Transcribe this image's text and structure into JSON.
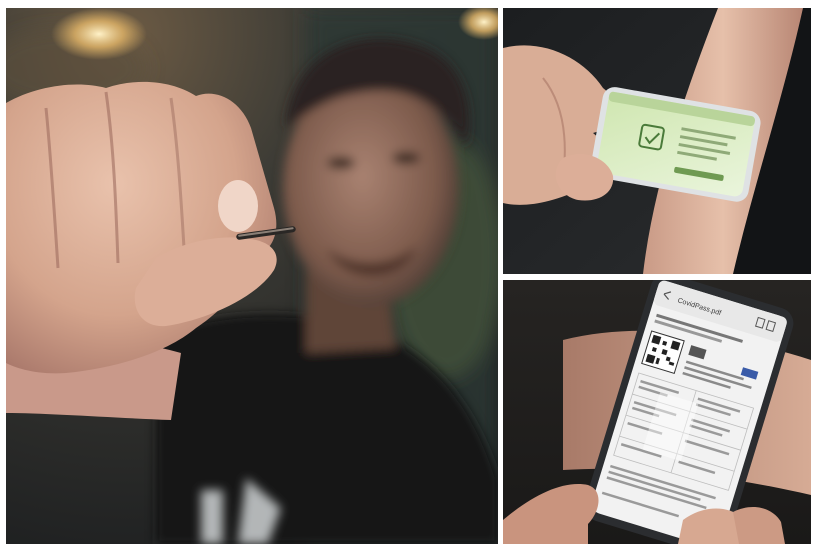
{
  "photos": {
    "main": {
      "description_icon": "person-holding-implant-chip"
    },
    "top_right": {
      "description_icon": "phone-scanning-arm"
    },
    "bottom_right": {
      "description_icon": "phone-showing-certificate"
    }
  },
  "phone_app": {
    "title": "CovidPass.pdf"
  },
  "colors": {
    "background": "#ffffff",
    "shirt": "#151719",
    "screen_green": "#dff0c6",
    "screen_white": "#f2f2f2"
  }
}
